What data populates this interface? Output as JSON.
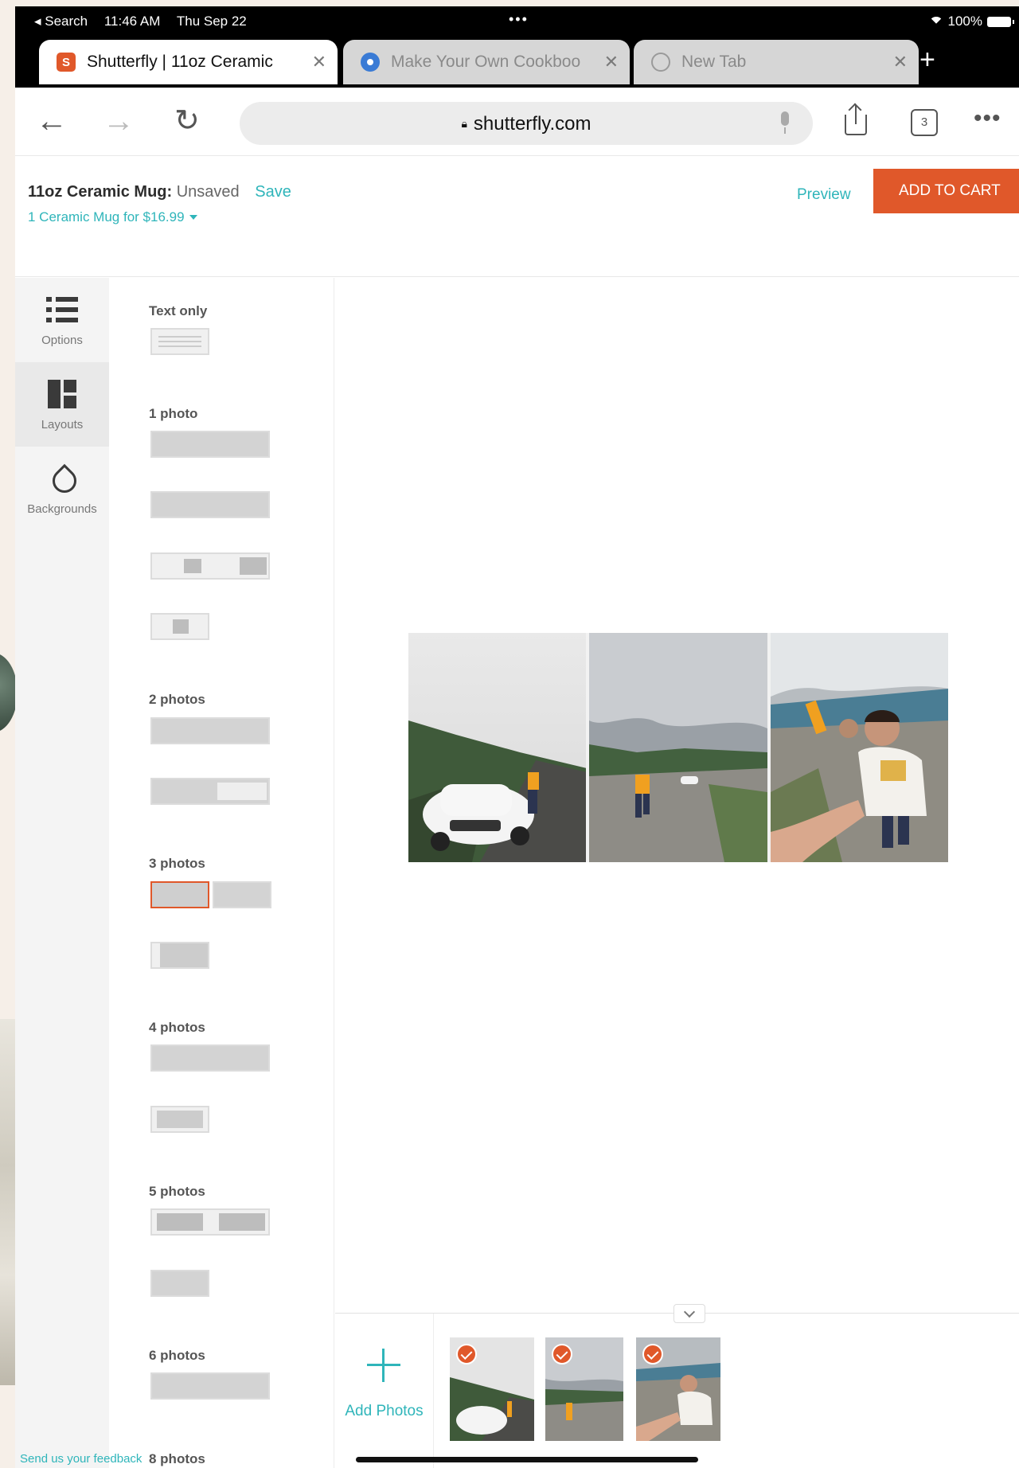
{
  "status_bar": {
    "back_app": "◂ Search",
    "time": "11:46 AM",
    "date": "Thu Sep 22",
    "dots": "•••",
    "battery": "100%"
  },
  "tabs": [
    {
      "label": "Shutterfly | 11oz Ceramic",
      "favicon": "S",
      "favicon_color": "#e0582a",
      "active": true
    },
    {
      "label": "Make Your Own Cookboo",
      "favicon": "C",
      "favicon_color": "#3a7bd5",
      "active": false
    },
    {
      "label": "New Tab",
      "favicon": "globe",
      "favicon_color": "#9a9a9a",
      "active": false
    }
  ],
  "toolbar": {
    "url": "shutterfly.com",
    "tab_count": "3"
  },
  "header": {
    "project_name": "11oz Ceramic Mug:",
    "project_status": "Unsaved",
    "save_label": "Save",
    "price_label": "1 Ceramic Mug for $16.99",
    "preview_label": "Preview",
    "cart_label": "ADD TO CART"
  },
  "rail": {
    "options": "Options",
    "layouts": "Layouts",
    "backgrounds": "Backgrounds",
    "feedback": "Send us your feedback"
  },
  "layouts": {
    "text_only": "Text only",
    "one_photo": "1 photo",
    "two_photos": "2 photos",
    "three_photos": "3 photos",
    "four_photos": "4 photos",
    "five_photos": "5 photos",
    "six_photos": "6 photos",
    "eight_photos": "8 photos",
    "selected": "3 photos"
  },
  "tray": {
    "add_label": "Add Photos",
    "photo_count": 3
  },
  "colors": {
    "accent_teal": "#2fb5ba",
    "brand_orange": "#e0582a"
  }
}
